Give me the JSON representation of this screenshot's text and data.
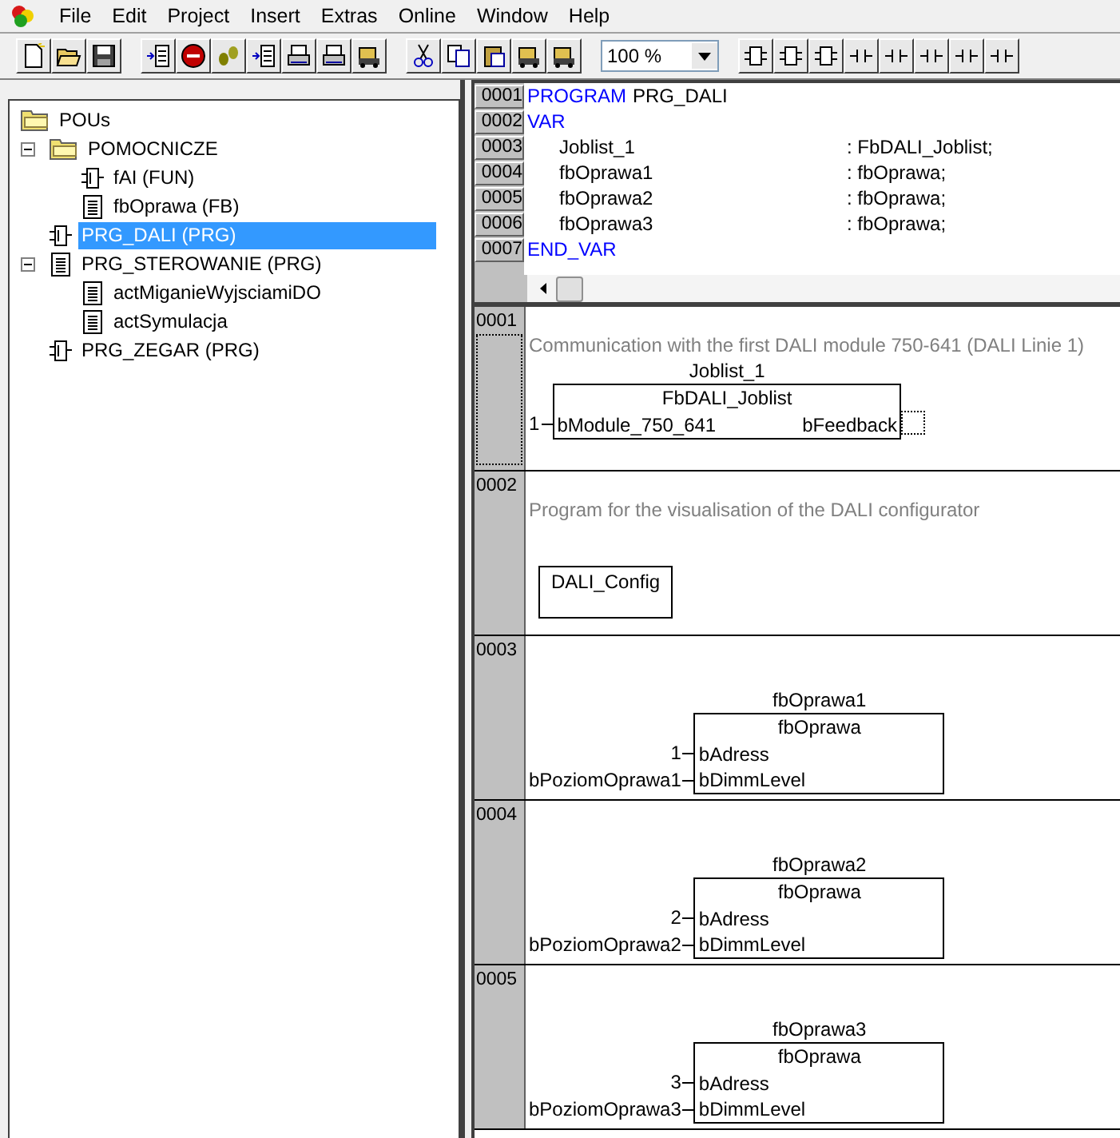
{
  "menu": [
    "File",
    "Edit",
    "Project",
    "Insert",
    "Extras",
    "Online",
    "Window",
    "Help"
  ],
  "toolbar": {
    "zoom": "100 %"
  },
  "tree": {
    "label": "POUs",
    "kind": "folder",
    "selected": false,
    "children": [
      {
        "label": "POMOCNICZE",
        "kind": "folder",
        "selected": false,
        "expanded": true,
        "children": [
          {
            "label": "fAI (FUN)",
            "kind": "block",
            "selected": false
          },
          {
            "label": "fbOprawa (FB)",
            "kind": "document",
            "selected": false
          }
        ]
      },
      {
        "label": "PRG_DALI (PRG)",
        "kind": "block",
        "selected": true
      },
      {
        "label": "PRG_STEROWANIE (PRG)",
        "kind": "document",
        "selected": false,
        "expanded": true,
        "children": [
          {
            "label": "actMiganieWyjsciamiDO",
            "kind": "document",
            "selected": false
          },
          {
            "label": "actSymulacja",
            "kind": "document",
            "selected": false
          }
        ]
      },
      {
        "label": "PRG_ZEGAR (PRG)",
        "kind": "block",
        "selected": false
      }
    ]
  },
  "declaration": {
    "lines": [
      {
        "number": "0001",
        "kind": "keyword",
        "keyword": "PROGRAM",
        "text": "PRG_DALI"
      },
      {
        "number": "0002",
        "kind": "keyword",
        "keyword": "VAR"
      },
      {
        "number": "0003",
        "kind": "var",
        "name": "Joblist_1",
        "type": ": FbDALI_Joblist;"
      },
      {
        "number": "0004",
        "kind": "var",
        "name": "fbOprawa1",
        "type": ": fbOprawa;"
      },
      {
        "number": "0005",
        "kind": "var",
        "name": "fbOprawa2",
        "type": ": fbOprawa;"
      },
      {
        "number": "0006",
        "kind": "var",
        "name": "fbOprawa3",
        "type": ": fbOprawa;"
      },
      {
        "number": "0007",
        "kind": "keyword",
        "keyword": "END_VAR"
      }
    ]
  },
  "networks": [
    {
      "number": "0001",
      "selected": true,
      "comment": "Communication with the first DALI module 750-641 (DALI Linie 1)",
      "block": {
        "kind": "fb",
        "instance": "Joblist_1",
        "type": "FbDALI_Joblist",
        "inputs": [
          {
            "value": "1",
            "pin": "bModule_750_641"
          }
        ],
        "outputs": [
          {
            "pin": "bFeedback"
          }
        ]
      }
    },
    {
      "number": "0002",
      "selected": false,
      "comment": "Program for the visualisation of the DALI configurator",
      "block": {
        "kind": "box",
        "name": "DALI_Config"
      }
    },
    {
      "number": "0003",
      "selected": false,
      "block": {
        "kind": "fb",
        "instance": "fbOprawa1",
        "type": "fbOprawa",
        "inputs": [
          {
            "value": "1",
            "pin": "bAdress"
          },
          {
            "value": "bPoziomOprawa1",
            "pin": "bDimmLevel"
          }
        ]
      }
    },
    {
      "number": "0004",
      "selected": false,
      "block": {
        "kind": "fb",
        "instance": "fbOprawa2",
        "type": "fbOprawa",
        "inputs": [
          {
            "value": "2",
            "pin": "bAdress"
          },
          {
            "value": "bPoziomOprawa2",
            "pin": "bDimmLevel"
          }
        ]
      }
    },
    {
      "number": "0005",
      "selected": false,
      "block": {
        "kind": "fb",
        "instance": "fbOprawa3",
        "type": "fbOprawa",
        "inputs": [
          {
            "value": "3",
            "pin": "bAdress"
          },
          {
            "value": "bPoziomOprawa3",
            "pin": "bDimmLevel"
          }
        ]
      }
    }
  ]
}
